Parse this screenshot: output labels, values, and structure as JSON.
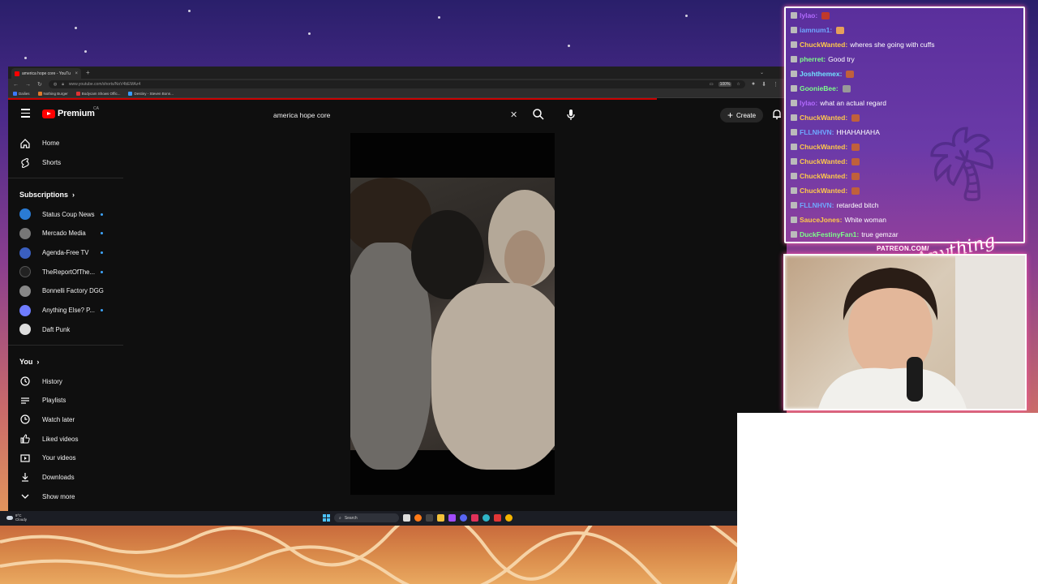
{
  "browser": {
    "tab_title": "america hope core - YouTu",
    "url": "www.youtube.com/shorts/NoV4bEMAz4",
    "zoom": "100%",
    "bookmarks": [
      "Dailies",
      "Nothing Burger",
      "Bodycam Shows Offic...",
      "Destiny - Steven Bonn..."
    ]
  },
  "youtube": {
    "brand": "Premium",
    "region": "CA",
    "search_query": "america hope core",
    "create_label": "Create",
    "nav": [
      {
        "label": "Home",
        "icon": "home-icon"
      },
      {
        "label": "Shorts",
        "icon": "shorts-icon"
      }
    ],
    "subscriptions_label": "Subscriptions",
    "subscriptions": [
      {
        "label": "Status Coup News",
        "color": "#2a7bd4",
        "live": true
      },
      {
        "label": "Mercado Media",
        "color": "#777777",
        "live": true
      },
      {
        "label": "Agenda-Free TV",
        "color": "#3a5fbf",
        "live": true
      },
      {
        "label": "TheReportOfThe...",
        "color": "#222222",
        "live": true
      },
      {
        "label": "Bonnelli Factory DGG",
        "color": "#888888",
        "live": false
      },
      {
        "label": "Anything Else? P...",
        "color": "#6f7cff",
        "live": true
      },
      {
        "label": "Daft Punk",
        "color": "#dddddd",
        "live": false
      }
    ],
    "you_label": "You",
    "you_items": [
      {
        "label": "History",
        "icon": "history-icon"
      },
      {
        "label": "Playlists",
        "icon": "playlists-icon"
      },
      {
        "label": "Watch later",
        "icon": "watch-later-icon"
      },
      {
        "label": "Liked videos",
        "icon": "liked-icon"
      },
      {
        "label": "Your videos",
        "icon": "your-videos-icon"
      },
      {
        "label": "Downloads",
        "icon": "downloads-icon"
      },
      {
        "label": "Show more",
        "icon": "chevron-down-icon"
      }
    ]
  },
  "taskbar": {
    "temp": "9°C",
    "condition": "Cloudy",
    "search_label": "Search"
  },
  "chat": {
    "messages": [
      {
        "user": "lylao:",
        "color": "#b36bff",
        "text": "",
        "emote": "#c0392b"
      },
      {
        "user": "iamnum1:",
        "color": "#6fa8ff",
        "text": "",
        "emote": "#e6a05a"
      },
      {
        "user": "ChuckWanted:",
        "color": "#ffc94a",
        "text": "wheres she going with cuffs",
        "emote": ""
      },
      {
        "user": "pherret:",
        "color": "#7dff8a",
        "text": "Good try",
        "emote": ""
      },
      {
        "user": "Joshthemex:",
        "color": "#6fe0ff",
        "text": "",
        "emote": "#c0603b"
      },
      {
        "user": "GoonieBee:",
        "color": "#7dff8a",
        "text": "",
        "emote": "#999999"
      },
      {
        "user": "lylao:",
        "color": "#b36bff",
        "text": "what an actual regard",
        "emote": ""
      },
      {
        "user": "ChuckWanted:",
        "color": "#ffc94a",
        "text": "",
        "emote": "#c0603b"
      },
      {
        "user": "FLLNHVN:",
        "color": "#6fa8ff",
        "text": "HHAHAHAHA",
        "emote": ""
      },
      {
        "user": "ChuckWanted:",
        "color": "#ffc94a",
        "text": "",
        "emote": "#c0603b"
      },
      {
        "user": "ChuckWanted:",
        "color": "#ffc94a",
        "text": "",
        "emote": "#c0603b"
      },
      {
        "user": "ChuckWanted:",
        "color": "#ffc94a",
        "text": "",
        "emote": "#c0603b"
      },
      {
        "user": "ChuckWanted:",
        "color": "#ffc94a",
        "text": "",
        "emote": "#c0603b"
      },
      {
        "user": "FLLNHVN:",
        "color": "#6fa8ff",
        "text": "retarded bitch",
        "emote": ""
      },
      {
        "user": "SauceJones:",
        "color": "#ffc94a",
        "text": "White woman",
        "emote": ""
      },
      {
        "user": "DuckFestinyFan1:",
        "color": "#7dff8a",
        "text": "true gemzar",
        "emote": ""
      }
    ]
  },
  "overlay": {
    "patreon": "PATREON.COM/",
    "signature": "Anything Else?"
  }
}
